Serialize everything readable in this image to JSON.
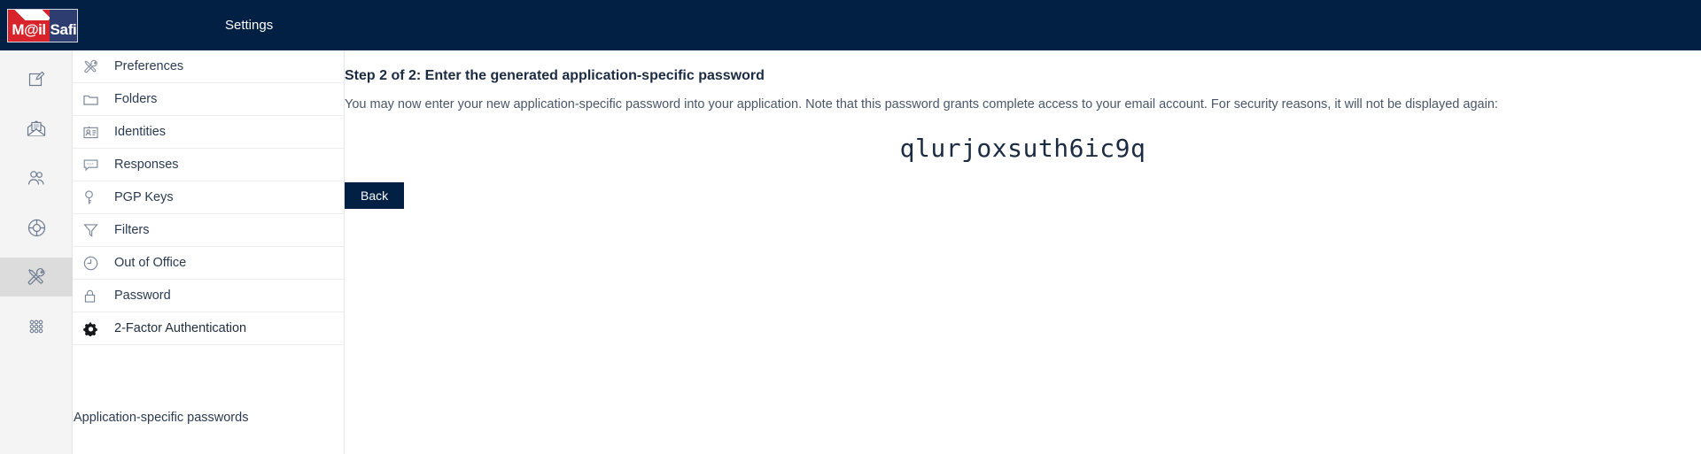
{
  "header": {
    "logo": {
      "part1": "M@il",
      "part2": "Safi"
    },
    "title": "Settings"
  },
  "rail": {
    "items": [
      {
        "name": "compose",
        "icon": "compose-icon",
        "active": false
      },
      {
        "name": "mail",
        "icon": "envelope-open-icon",
        "active": false
      },
      {
        "name": "contacts",
        "icon": "people-icon",
        "active": false
      },
      {
        "name": "support",
        "icon": "lifebuoy-icon",
        "active": false
      },
      {
        "name": "settings",
        "icon": "tools-icon",
        "active": true
      },
      {
        "name": "apps",
        "icon": "grid-dots-icon",
        "active": false
      }
    ]
  },
  "settings_menu": {
    "items": [
      {
        "label": "Preferences",
        "icon": "tools-icon"
      },
      {
        "label": "Folders",
        "icon": "folder-icon"
      },
      {
        "label": "Identities",
        "icon": "id-card-icon"
      },
      {
        "label": "Responses",
        "icon": "speech-bubble-icon"
      },
      {
        "label": "PGP Keys",
        "icon": "key-icon"
      },
      {
        "label": "Filters",
        "icon": "funnel-icon"
      },
      {
        "label": "Out of Office",
        "icon": "clock-icon"
      },
      {
        "label": "Password",
        "icon": "lock-icon"
      },
      {
        "label": "2-Factor Authentication",
        "icon": "gear-icon"
      }
    ],
    "app_passwords_label": "Application-specific passwords"
  },
  "main": {
    "title": "Step 2 of 2: Enter the generated application-specific password",
    "description": "You may now enter your new application-specific password into your application. Note that this password grants complete access to your email account. For security reasons, it will not be displayed again:",
    "password": "qlurjoxsuth6ic9q",
    "back_label": "Back"
  },
  "colors": {
    "brand_navy": "#012044",
    "logo_red": "#d8232a",
    "logo_navy": "#2e3d70",
    "rail_bg": "#f4f4f4",
    "rail_active": "#dcdcdc"
  }
}
